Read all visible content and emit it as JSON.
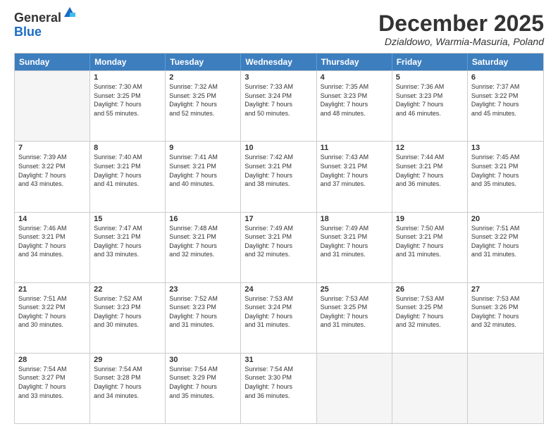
{
  "logo": {
    "general": "General",
    "blue": "Blue"
  },
  "header": {
    "month": "December 2025",
    "location": "Dzialdowo, Warmia-Masuria, Poland"
  },
  "days": [
    "Sunday",
    "Monday",
    "Tuesday",
    "Wednesday",
    "Thursday",
    "Friday",
    "Saturday"
  ],
  "weeks": [
    [
      {
        "day": "",
        "sunrise": "",
        "sunset": "",
        "daylight": ""
      },
      {
        "day": "1",
        "sunrise": "Sunrise: 7:30 AM",
        "sunset": "Sunset: 3:25 PM",
        "daylight": "Daylight: 7 hours and 55 minutes."
      },
      {
        "day": "2",
        "sunrise": "Sunrise: 7:32 AM",
        "sunset": "Sunset: 3:25 PM",
        "daylight": "Daylight: 7 hours and 52 minutes."
      },
      {
        "day": "3",
        "sunrise": "Sunrise: 7:33 AM",
        "sunset": "Sunset: 3:24 PM",
        "daylight": "Daylight: 7 hours and 50 minutes."
      },
      {
        "day": "4",
        "sunrise": "Sunrise: 7:35 AM",
        "sunset": "Sunset: 3:23 PM",
        "daylight": "Daylight: 7 hours and 48 minutes."
      },
      {
        "day": "5",
        "sunrise": "Sunrise: 7:36 AM",
        "sunset": "Sunset: 3:23 PM",
        "daylight": "Daylight: 7 hours and 46 minutes."
      },
      {
        "day": "6",
        "sunrise": "Sunrise: 7:37 AM",
        "sunset": "Sunset: 3:22 PM",
        "daylight": "Daylight: 7 hours and 45 minutes."
      }
    ],
    [
      {
        "day": "7",
        "sunrise": "Sunrise: 7:39 AM",
        "sunset": "Sunset: 3:22 PM",
        "daylight": "Daylight: 7 hours and 43 minutes."
      },
      {
        "day": "8",
        "sunrise": "Sunrise: 7:40 AM",
        "sunset": "Sunset: 3:21 PM",
        "daylight": "Daylight: 7 hours and 41 minutes."
      },
      {
        "day": "9",
        "sunrise": "Sunrise: 7:41 AM",
        "sunset": "Sunset: 3:21 PM",
        "daylight": "Daylight: 7 hours and 40 minutes."
      },
      {
        "day": "10",
        "sunrise": "Sunrise: 7:42 AM",
        "sunset": "Sunset: 3:21 PM",
        "daylight": "Daylight: 7 hours and 38 minutes."
      },
      {
        "day": "11",
        "sunrise": "Sunrise: 7:43 AM",
        "sunset": "Sunset: 3:21 PM",
        "daylight": "Daylight: 7 hours and 37 minutes."
      },
      {
        "day": "12",
        "sunrise": "Sunrise: 7:44 AM",
        "sunset": "Sunset: 3:21 PM",
        "daylight": "Daylight: 7 hours and 36 minutes."
      },
      {
        "day": "13",
        "sunrise": "Sunrise: 7:45 AM",
        "sunset": "Sunset: 3:21 PM",
        "daylight": "Daylight: 7 hours and 35 minutes."
      }
    ],
    [
      {
        "day": "14",
        "sunrise": "Sunrise: 7:46 AM",
        "sunset": "Sunset: 3:21 PM",
        "daylight": "Daylight: 7 hours and 34 minutes."
      },
      {
        "day": "15",
        "sunrise": "Sunrise: 7:47 AM",
        "sunset": "Sunset: 3:21 PM",
        "daylight": "Daylight: 7 hours and 33 minutes."
      },
      {
        "day": "16",
        "sunrise": "Sunrise: 7:48 AM",
        "sunset": "Sunset: 3:21 PM",
        "daylight": "Daylight: 7 hours and 32 minutes."
      },
      {
        "day": "17",
        "sunrise": "Sunrise: 7:49 AM",
        "sunset": "Sunset: 3:21 PM",
        "daylight": "Daylight: 7 hours and 32 minutes."
      },
      {
        "day": "18",
        "sunrise": "Sunrise: 7:49 AM",
        "sunset": "Sunset: 3:21 PM",
        "daylight": "Daylight: 7 hours and 31 minutes."
      },
      {
        "day": "19",
        "sunrise": "Sunrise: 7:50 AM",
        "sunset": "Sunset: 3:21 PM",
        "daylight": "Daylight: 7 hours and 31 minutes."
      },
      {
        "day": "20",
        "sunrise": "Sunrise: 7:51 AM",
        "sunset": "Sunset: 3:22 PM",
        "daylight": "Daylight: 7 hours and 31 minutes."
      }
    ],
    [
      {
        "day": "21",
        "sunrise": "Sunrise: 7:51 AM",
        "sunset": "Sunset: 3:22 PM",
        "daylight": "Daylight: 7 hours and 30 minutes."
      },
      {
        "day": "22",
        "sunrise": "Sunrise: 7:52 AM",
        "sunset": "Sunset: 3:23 PM",
        "daylight": "Daylight: 7 hours and 30 minutes."
      },
      {
        "day": "23",
        "sunrise": "Sunrise: 7:52 AM",
        "sunset": "Sunset: 3:23 PM",
        "daylight": "Daylight: 7 hours and 31 minutes."
      },
      {
        "day": "24",
        "sunrise": "Sunrise: 7:53 AM",
        "sunset": "Sunset: 3:24 PM",
        "daylight": "Daylight: 7 hours and 31 minutes."
      },
      {
        "day": "25",
        "sunrise": "Sunrise: 7:53 AM",
        "sunset": "Sunset: 3:25 PM",
        "daylight": "Daylight: 7 hours and 31 minutes."
      },
      {
        "day": "26",
        "sunrise": "Sunrise: 7:53 AM",
        "sunset": "Sunset: 3:25 PM",
        "daylight": "Daylight: 7 hours and 32 minutes."
      },
      {
        "day": "27",
        "sunrise": "Sunrise: 7:53 AM",
        "sunset": "Sunset: 3:26 PM",
        "daylight": "Daylight: 7 hours and 32 minutes."
      }
    ],
    [
      {
        "day": "28",
        "sunrise": "Sunrise: 7:54 AM",
        "sunset": "Sunset: 3:27 PM",
        "daylight": "Daylight: 7 hours and 33 minutes."
      },
      {
        "day": "29",
        "sunrise": "Sunrise: 7:54 AM",
        "sunset": "Sunset: 3:28 PM",
        "daylight": "Daylight: 7 hours and 34 minutes."
      },
      {
        "day": "30",
        "sunrise": "Sunrise: 7:54 AM",
        "sunset": "Sunset: 3:29 PM",
        "daylight": "Daylight: 7 hours and 35 minutes."
      },
      {
        "day": "31",
        "sunrise": "Sunrise: 7:54 AM",
        "sunset": "Sunset: 3:30 PM",
        "daylight": "Daylight: 7 hours and 36 minutes."
      },
      {
        "day": "",
        "sunrise": "",
        "sunset": "",
        "daylight": ""
      },
      {
        "day": "",
        "sunrise": "",
        "sunset": "",
        "daylight": ""
      },
      {
        "day": "",
        "sunrise": "",
        "sunset": "",
        "daylight": ""
      }
    ]
  ]
}
